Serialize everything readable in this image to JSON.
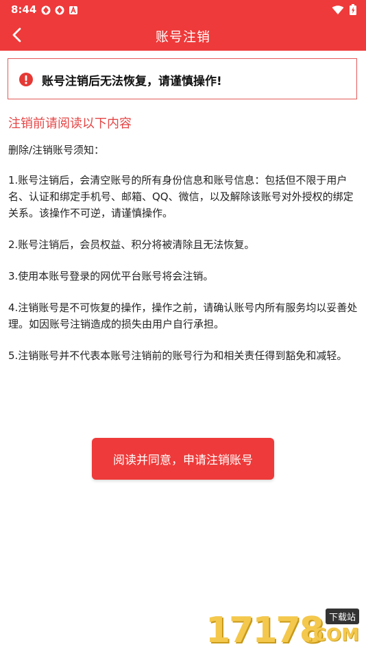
{
  "status_bar": {
    "time": "8:44",
    "icons": [
      "sync-icon",
      "sync-icon",
      "app-a-icon",
      "wifi-icon",
      "battery-charging-icon"
    ]
  },
  "app_bar": {
    "title": "账号注销",
    "back_icon": "chevron-left-icon"
  },
  "warning": {
    "icon": "exclamation-circle-icon",
    "text": "账号注销后无法恢复，请谨慎操作!"
  },
  "subheading": "注销前请阅读以下内容",
  "notice": {
    "intro": "删除/注销账号须知：",
    "items": [
      "1.账号注销后，会清空账号的所有身份信息和账号信息：包括但不限于用户名、认证和绑定手机号、邮箱、QQ、微信，以及解除该账号对外授权的绑定关系。该操作不可逆，请谨慎操作。",
      "2.账号注销后，会员权益、积分将被清除且无法恢复。",
      "3.使用本账号登录的网优平台账号将会注销。",
      "4.注销账号是不可恢复的操作，操作之前，请确认账号内所有服务均以妥善处理。如因账号注销造成的损失由用户自行承担。",
      "5.注销账号并不代表本账号注销前的账号行为和相关责任得到豁免和减轻。"
    ]
  },
  "cta_label": "阅读并同意，申请注销账号",
  "watermark": {
    "number": "17178",
    "badge": "下载站",
    "domain": ".COM"
  },
  "colors": {
    "brand": "#ee3a3a",
    "warning_border": "#e55757",
    "subheading": "#e54444",
    "watermark": "#f4c84d"
  }
}
